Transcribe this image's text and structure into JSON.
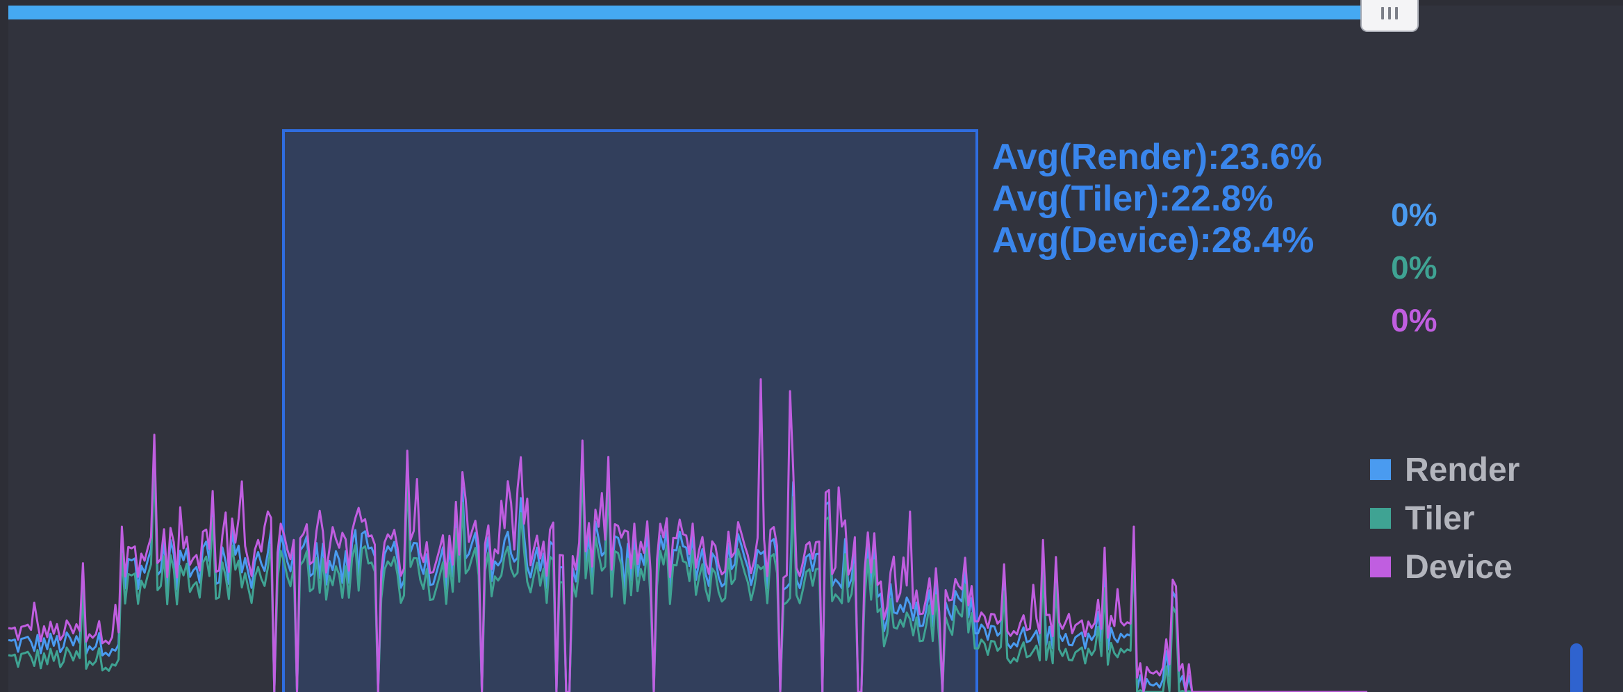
{
  "chart_data": {
    "type": "line",
    "title": "",
    "xlabel": "",
    "ylabel": "",
    "x_count": 420,
    "ylim": [
      0,
      100
    ],
    "grid": false,
    "legend_position": "right",
    "series": [
      {
        "name": "Render",
        "color": "#4a9bf0",
        "base_level": 22
      },
      {
        "name": "Tiler",
        "color": "#3fa393",
        "base_level": 20
      },
      {
        "name": "Device",
        "color": "#c05ee0",
        "base_level": 25
      }
    ],
    "segments": [
      {
        "from": 0,
        "to": 35,
        "level": 8
      },
      {
        "from": 35,
        "to": 112,
        "level": 22
      },
      {
        "from": 112,
        "to": 268,
        "level": 22
      },
      {
        "from": 268,
        "to": 300,
        "level": 14
      },
      {
        "from": 300,
        "to": 348,
        "level": 9
      },
      {
        "from": 348,
        "to": 365,
        "level": 1
      },
      {
        "from": 365,
        "to": 420,
        "level": 0
      }
    ],
    "selection": {
      "from_index": 72,
      "to_index": 252
    }
  },
  "averages": [
    {
      "label": "Avg(Render):23.6%"
    },
    {
      "label": "Avg(Tiler):22.8%"
    },
    {
      "label": "Avg(Device):28.4%"
    }
  ],
  "current_values": [
    {
      "text": "0%",
      "color": "#4a9bf0"
    },
    {
      "text": "0%",
      "color": "#3fa393"
    },
    {
      "text": "0%",
      "color": "#c05ee0"
    }
  ],
  "legend": [
    {
      "label": "Render",
      "color": "#4a9bf0"
    },
    {
      "label": "Tiler",
      "color": "#3fa393"
    },
    {
      "label": "Device",
      "color": "#c05ee0"
    }
  ]
}
